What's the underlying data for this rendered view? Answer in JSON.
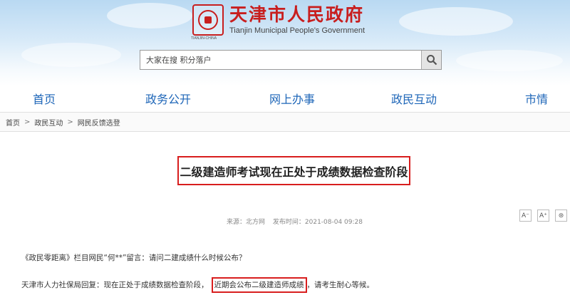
{
  "header": {
    "site_title": "天津市人民政府",
    "site_subtitle": "Tianjin Municipal People's Government",
    "emblem_caption": "TIANJIN-CHINA"
  },
  "search": {
    "placeholder": "大家在搜 积分落户",
    "button_icon": "search-icon"
  },
  "nav": {
    "items": [
      {
        "label": "首页"
      },
      {
        "label": "政务公开"
      },
      {
        "label": "网上办事"
      },
      {
        "label": "政民互动"
      },
      {
        "label": "市情"
      }
    ]
  },
  "breadcrumb": {
    "items": [
      "首页",
      "政民互动",
      "网民反馈选登"
    ],
    "separator": ">"
  },
  "article": {
    "title": "二级建造师考试现在正处于成绩数据检查阶段",
    "source": "来源：北方网",
    "publish_time": "发布时间：2021-08-04 09:28",
    "font_controls": [
      "A⁻",
      "A⁺",
      "⊜"
    ],
    "question": "《政民零距离》栏目网民“何**”留言：请问二建成绩什么时候公布？",
    "answer_part1": "天津市人力社保局回复：现在正处于成绩数据检查阶段，",
    "answer_highlight": "近期会公布二级建造师成绩",
    "answer_part2": "，请考生耐心等候。"
  },
  "colors": {
    "brand_red": "#c81e1e",
    "nav_blue": "#1e66b8",
    "highlight_red": "#d81e1e"
  }
}
